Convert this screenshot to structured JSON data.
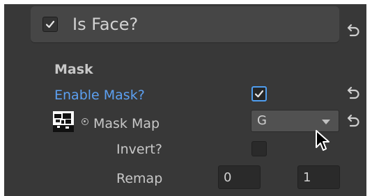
{
  "header": {
    "title": "Is Face?",
    "checked": true
  },
  "section": {
    "title": "Mask"
  },
  "enable_mask": {
    "label": "Enable Mask?",
    "checked": true
  },
  "mask_map": {
    "label": "Mask Map",
    "selected": "G",
    "options": [
      "G"
    ]
  },
  "invert": {
    "label": "Invert?",
    "checked": false
  },
  "remap": {
    "label": "Remap",
    "min": "0",
    "max": "1"
  },
  "icons": {
    "revert": "revert-arrow-icon",
    "check": "checkmark-icon",
    "object_picker": "object-picker-target-icon",
    "cursor": "mouse-cursor-icon"
  },
  "colors": {
    "background": "#383838",
    "header": "#464646",
    "accent_blue": "#5ca0f2"
  }
}
